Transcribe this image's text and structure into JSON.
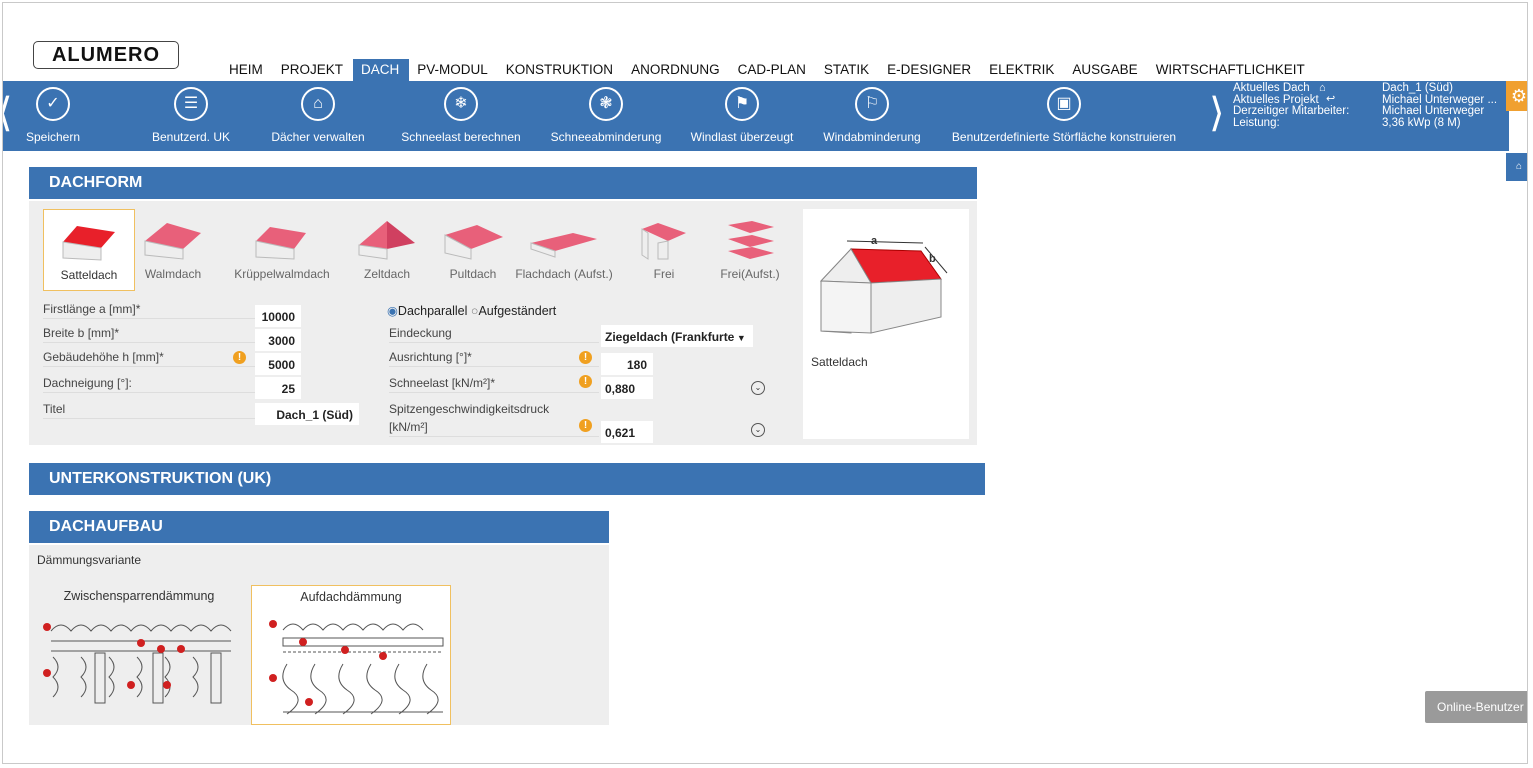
{
  "logo": "ALUMERO",
  "nav": {
    "tabs": [
      "HEIM",
      "PROJEKT",
      "DACH",
      "PV-MODUL",
      "KONSTRUKTION",
      "ANORDNUNG",
      "CAD-PLAN",
      "STATIK",
      "E-DESIGNER",
      "ELEKTRIK",
      "AUSGABE",
      "WIRTSCHAFTLICHKEIT"
    ],
    "active": "DACH"
  },
  "toolbar": {
    "items": [
      {
        "label": "Speichern",
        "icon": "check-icon"
      },
      {
        "label": "Benutzerd. UK",
        "icon": "list-icon"
      },
      {
        "label": "Dächer verwalten",
        "icon": "roof-manage-icon"
      },
      {
        "label": "Schneelast berechnen",
        "icon": "snowflake-icon"
      },
      {
        "label": "Schneeabminderung",
        "icon": "snow-gear-icon"
      },
      {
        "label": "Windlast überzeugt",
        "icon": "windsock-icon"
      },
      {
        "label": "Windabminderung",
        "icon": "wind-flag-icon"
      },
      {
        "label": "Benutzerdefinierte Störfläche konstruieren",
        "icon": "square-icon"
      }
    ]
  },
  "info": {
    "labels": [
      "Aktuelles Dach",
      "Aktuelles Projekt",
      "Derzeitiger Mitarbeiter:",
      "Leistung:"
    ],
    "values": [
      "Dach_1 (Süd)",
      "Michael Unterweger ...",
      "Michael Unterweger",
      "3,36 kWp (8 M)"
    ]
  },
  "dachform": {
    "title": "DACHFORM",
    "types": [
      "Satteldach",
      "Walmdach",
      "Krüppelwalmdach",
      "Zeltdach",
      "Pultdach",
      "Flachdach (Aufst.)",
      "Frei",
      "Frei(Aufst.)"
    ],
    "selected": "Satteldach",
    "fields_left": [
      {
        "label": "Firstlänge a [mm]*",
        "value": "10000",
        "info": false
      },
      {
        "label": "Breite b [mm]*",
        "value": "3000",
        "info": false
      },
      {
        "label": "Gebäudehöhe h [mm]*",
        "value": "5000",
        "info": true
      },
      {
        "label": "Dachneigung [°]:",
        "value": "25",
        "info": false
      },
      {
        "label": "Titel",
        "value": "Dach_1 (Süd)",
        "info": false
      }
    ],
    "mount": {
      "option1": "Dachparallel",
      "option2": "Aufgeständert",
      "selected": "Dachparallel"
    },
    "fields_right": [
      {
        "label": "Eindeckung",
        "value": "Ziegeldach (Frankfurte"
      },
      {
        "label": "Ausrichtung [°]*",
        "value": "180"
      },
      {
        "label": "Schneelast [kN/m²]*",
        "value": "0,880"
      },
      {
        "label": "Spitzengeschwindigkeitsdruck",
        "label2": "[kN/m²]",
        "value": "0,621"
      }
    ],
    "preview_label": "Satteldach",
    "dim_a": "a",
    "dim_b": "b"
  },
  "uk": {
    "title": "UNTERKONSTRUKTION (UK)"
  },
  "dachaufbau": {
    "title": "DACHAUFBAU",
    "subtitle": "Dämmungsvariante",
    "variants": [
      "Zwischensparrendämmung",
      "Aufdachdämmung"
    ],
    "selected": "Aufdachdämmung"
  },
  "online": "Online-Benutzer",
  "colors": {
    "primary": "#3b73b2",
    "accent": "#f0a030",
    "roof": "#e8202a"
  }
}
